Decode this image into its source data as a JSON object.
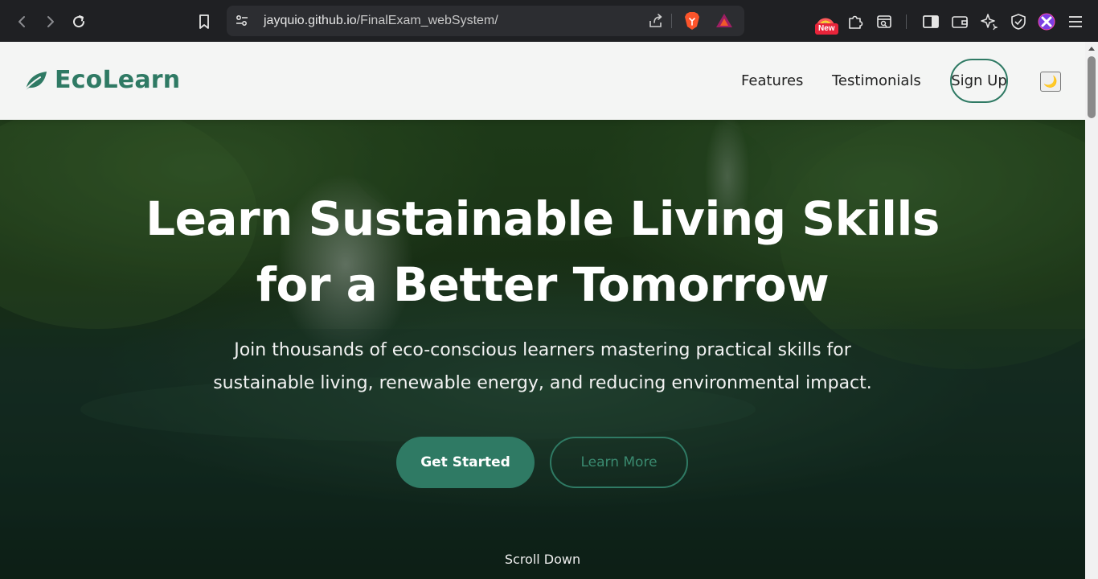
{
  "browser": {
    "url_host": "jayquio.github.io",
    "url_path": "/FinalExam_webSystem/",
    "new_badge": "New"
  },
  "navbar": {
    "brand": "EcoLearn",
    "links": [
      "Features",
      "Testimonials"
    ],
    "signup": "Sign Up",
    "theme_toggle": "🌙"
  },
  "hero": {
    "title_line1": "Learn Sustainable Living Skills",
    "title_line2": "for a Better Tomorrow",
    "subtitle_line1": "Join thousands of eco-conscious learners mastering practical skills for",
    "subtitle_line2": "sustainable living, renewable energy, and reducing environmental impact.",
    "primary_button": "Get Started",
    "secondary_button": "Learn More",
    "scroll_hint": "Scroll Down"
  },
  "colors": {
    "brand": "#2f7a64",
    "navbar_bg": "#f4f5f4",
    "chrome_bg": "#1f2023"
  }
}
